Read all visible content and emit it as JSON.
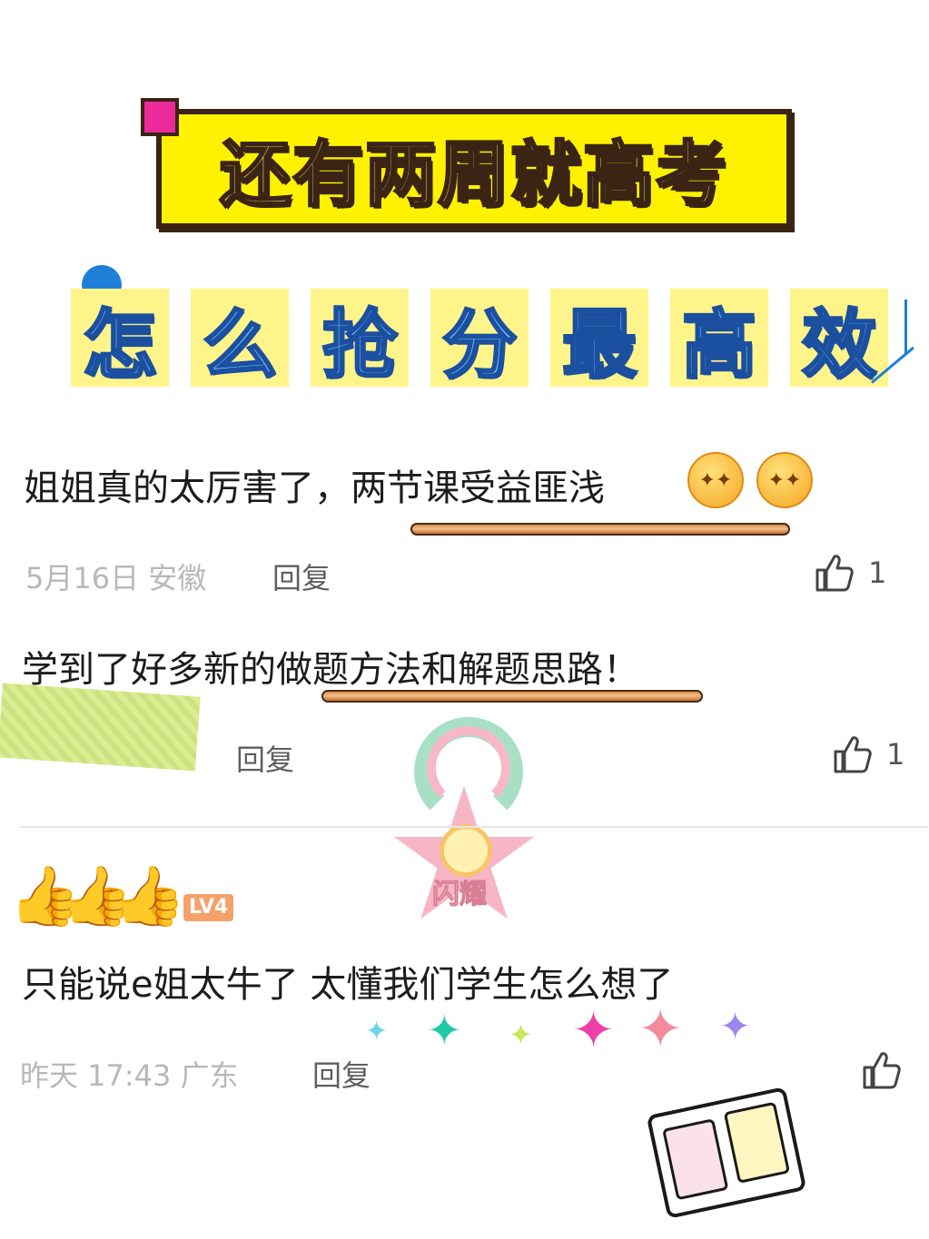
{
  "header": {
    "title": "还有两周就高考",
    "subtitle_chars": [
      "怎",
      "么",
      "抢",
      "分",
      "最",
      "高",
      "效"
    ]
  },
  "comments": [
    {
      "text": "姐姐真的太厉害了，两节课受益匪浅",
      "meta": "5月16日 安徽",
      "reply_label": "回复",
      "like_count": "1",
      "emojis": [
        "star-eyes-face-emoji",
        "star-eyes-face-emoji"
      ]
    },
    {
      "text": "学到了好多新的做题方法和解题思路！",
      "reply_label": "回复",
      "like_count": "1"
    },
    {
      "author_badge": "LV4",
      "text": "只能说e姐太牛了 太懂我们学生怎么想了",
      "meta": "昨天 17:43 广东",
      "reply_label": "回复"
    }
  ],
  "sticker": {
    "medal_label": "闪耀"
  },
  "colors": {
    "banner_yellow": "#fff200",
    "banner_border": "#3b2414",
    "subtitle_blue": "#7ec8ff",
    "accent_pink": "#ec2a9a"
  },
  "icons": {
    "like": "thumbs-up-outline-icon",
    "sparkles": [
      "sparkle-cyan",
      "sparkle-teal",
      "sparkle-lime",
      "sparkle-magenta",
      "sparkle-pink",
      "sparkle-purple"
    ]
  }
}
